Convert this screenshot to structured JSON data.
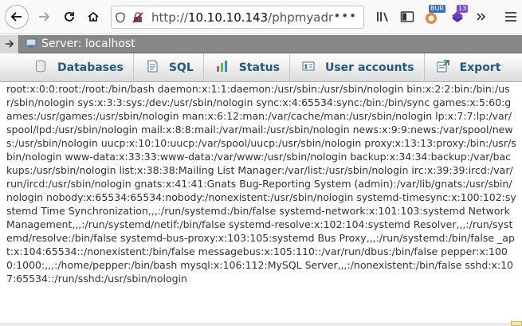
{
  "browser": {
    "url_prefix": "http://",
    "url_host": "10.10.10.143",
    "url_path": "/phpmyadmin",
    "url_more": "•••",
    "badges": {
      "bur": "BUR",
      "count": "13"
    }
  },
  "server": {
    "label": "Server: localhost"
  },
  "menu": [
    {
      "label": "Databases",
      "icon": "database-icon"
    },
    {
      "label": "SQL",
      "icon": "sql-icon"
    },
    {
      "label": "Status",
      "icon": "status-chart-icon"
    },
    {
      "label": "User accounts",
      "icon": "user-accounts-icon"
    },
    {
      "label": "Export",
      "icon": "export-icon"
    }
  ],
  "content": {
    "passwd": "root:x:0:0:root:/root:/bin/bash daemon:x:1:1:daemon:/usr/sbin:/usr/sbin/nologin bin:x:2:2:bin:/bin:/usr/sbin/nologin sys:x:3:3:sys:/dev:/usr/sbin/nologin sync:x:4:65534:sync:/bin:/bin/sync games:x:5:60:games:/usr/games:/usr/sbin/nologin man:x:6:12:man:/var/cache/man:/usr/sbin/nologin lp:x:7:7:lp:/var/spool/lpd:/usr/sbin/nologin mail:x:8:8:mail:/var/mail:/usr/sbin/nologin news:x:9:9:news:/var/spool/news:/usr/sbin/nologin uucp:x:10:10:uucp:/var/spool/uucp:/usr/sbin/nologin proxy:x:13:13:proxy:/bin:/usr/sbin/nologin www-data:x:33:33:www-data:/var/www:/usr/sbin/nologin backup:x:34:34:backup:/var/backups:/usr/sbin/nologin list:x:38:38:Mailing List Manager:/var/list:/usr/sbin/nologin irc:x:39:39:ircd:/var/run/ircd:/usr/sbin/nologin gnats:x:41:41:Gnats Bug-Reporting System (admin):/var/lib/gnats:/usr/sbin/nologin nobody:x:65534:65534:nobody:/nonexistent:/usr/sbin/nologin systemd-timesync:x:100:102:systemd Time Synchronization,,,:/run/systemd:/bin/false systemd-network:x:101:103:systemd Network Management,,,:/run/systemd/netif:/bin/false systemd-resolve:x:102:104:systemd Resolver,,,:/run/systemd/resolve:/bin/false systemd-bus-proxy:x:103:105:systemd Bus Proxy,,,:/run/systemd:/bin/false _apt:x:104:65534::/nonexistent:/bin/false messagebus:x:105:110::/var/run/dbus:/bin/false pepper:x:1000:1000:,,,:/home/pepper:/bin/bash mysql:x:106:112:MySQL Server,,,:/nonexistent:/bin/false sshd:x:107:65534::/run/sshd:/usr/sbin/nologin"
  }
}
